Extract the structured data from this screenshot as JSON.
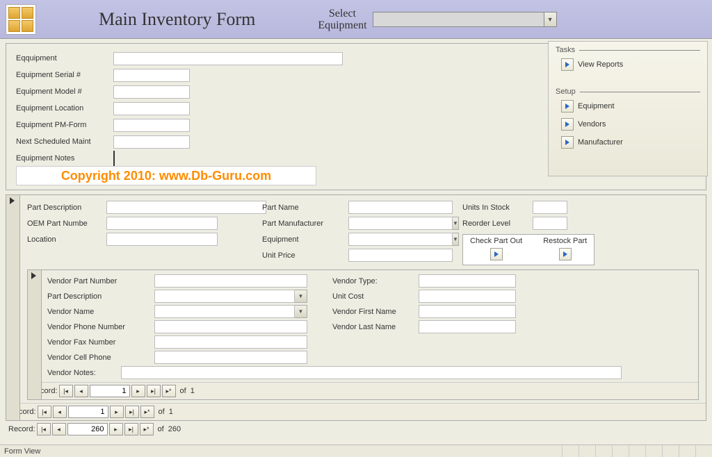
{
  "header": {
    "title": "Main Inventory Form",
    "select_label": "Select\nEquipment"
  },
  "equipment": {
    "labels": {
      "equipment": "Eqquipment",
      "serial": "Equipment Serial #",
      "model": "Equipment Model #",
      "location": "Equipment Location",
      "pmform": "Equipment PM-Form",
      "nextmaint": "Next Scheduled Maint",
      "notes": "Equipment Notes"
    },
    "values": {
      "equipment": "",
      "serial": "",
      "model": "",
      "location": "",
      "pmform": "",
      "nextmaint": ""
    },
    "copyright": "Copyright 2010: www.Db-Guru.com"
  },
  "taskpanel": {
    "tasks_head": "Tasks",
    "setup_head": "Setup",
    "view_reports": "View Reports",
    "equipment": "Equipment",
    "vendors": "Vendors",
    "manufacturer": "Manufacturer"
  },
  "partform": {
    "labels": {
      "part_desc": "Part Description",
      "oem_no": "OEM Part Numbe",
      "location": "Location",
      "part_name": "Part Name",
      "part_mfr": "Part Manufacturer",
      "equipment": "Equipment",
      "unit_price": "Unit Price",
      "units_in_stock": "Units In Stock",
      "reorder_level": "Reorder Level",
      "check_out": "Check Part Out",
      "restock": "Restock Part"
    }
  },
  "vendorform": {
    "labels": {
      "vpn": "Vendor Part Number",
      "part_desc": "Part Description",
      "vname": "Vendor Name",
      "vphone": "Vendor Phone Number",
      "vfax": "Vendor Fax Number",
      "vcell": "Vendor Cell Phone",
      "vnotes": "Vendor Notes:",
      "vtype": "Vendor Type:",
      "unit_cost": "Unit Cost",
      "vfirst": "Vendor First Name",
      "vlast": "Vendor Last Name"
    }
  },
  "recnav": {
    "label": "Record:",
    "of": "of",
    "inner": {
      "current": "1",
      "total": "1"
    },
    "mid": {
      "current": "1",
      "total": "1"
    },
    "outer": {
      "current": "260",
      "total": "260"
    }
  },
  "status": "Form View"
}
